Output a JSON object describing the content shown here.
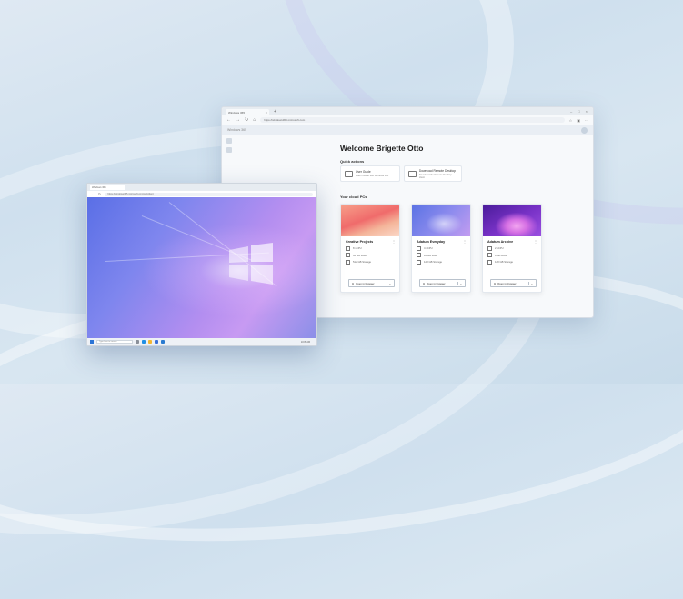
{
  "browser": {
    "tab_title": "Windows 365",
    "url": "https://windows365.microsoft.com",
    "app_name": "Windows 365",
    "welcome": "Welcome Brigette Otto",
    "quick_actions_label": "Quick actions",
    "quick_actions": [
      {
        "title": "User Guide",
        "subtitle": "Learn how to use Windows 365"
      },
      {
        "title": "Download Remote Desktop",
        "subtitle": "Download the Remote Desktop client"
      }
    ],
    "cloud_pcs_label": "Your cloud PCs",
    "pcs": [
      {
        "name": "Creative Projects",
        "cpu": "8 vCPU",
        "ram": "32 GB RAM",
        "storage": "512 GB Storage",
        "open": "Open in browser"
      },
      {
        "name": "Adatum Everyday",
        "cpu": "4 vCPU",
        "ram": "16 GB RAM",
        "storage": "128 GB Storage",
        "open": "Open in browser"
      },
      {
        "name": "Adatum Archive",
        "cpu": "2 vCPU",
        "ram": "8 GB RAM",
        "storage": "128 GB Storage",
        "open": "Open in browser"
      }
    ],
    "more_glyph": "⋮"
  },
  "remote": {
    "tab_title": "Windows 365",
    "url": "https://windows365.microsoft.com/webclient",
    "taskbar_search": "Type here to search",
    "tray_time": "10:05 AM"
  },
  "colors": {
    "background": "#d5e4f0",
    "start_button": "#2b74d6",
    "wallpaper_start": "#5a6fe6",
    "wallpaper_end": "#c79af2"
  },
  "icons": [
    "back-icon",
    "forward-icon",
    "refresh-icon",
    "home-icon",
    "windows-logo-icon",
    "more-icon",
    "external-link-icon",
    "chevron-down-icon"
  ]
}
